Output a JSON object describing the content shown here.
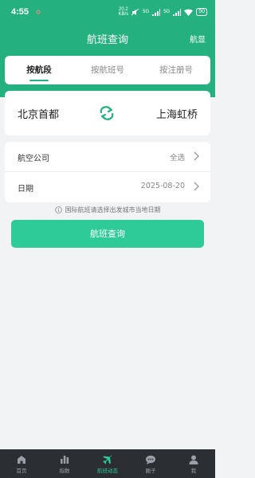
{
  "status_bar": {
    "time": "4:55",
    "speed_value": "20.2",
    "speed_unit": "KB/s",
    "signal_1": "5G",
    "signal_2": "5G",
    "battery": "50"
  },
  "header": {
    "title": "航班查询",
    "right_link": "航显"
  },
  "tabs": [
    {
      "label": "按航段",
      "active": true
    },
    {
      "label": "按航班号",
      "active": false
    },
    {
      "label": "按注册号",
      "active": false
    }
  ],
  "route": {
    "from": "北京首都",
    "to": "上海虹桥"
  },
  "form": {
    "airline_label": "航空公司",
    "airline_value": "全选",
    "date_label": "日期",
    "date_value": "2025-08-20"
  },
  "hint": "国际航班请选择出发城市当地日期",
  "search_button": "航班查询",
  "bottom_nav": [
    {
      "label": "首页",
      "icon": "home-icon",
      "active": false
    },
    {
      "label": "指数",
      "icon": "bar-chart-icon",
      "active": false
    },
    {
      "label": "航班动态",
      "icon": "airplane-icon",
      "active": true
    },
    {
      "label": "圈子",
      "icon": "chat-icon",
      "active": false
    },
    {
      "label": "我",
      "icon": "person-icon",
      "active": false
    }
  ],
  "colors": {
    "brand": "#25b07f",
    "button": "#2ecb98",
    "nav_bg": "#2b2e33"
  }
}
